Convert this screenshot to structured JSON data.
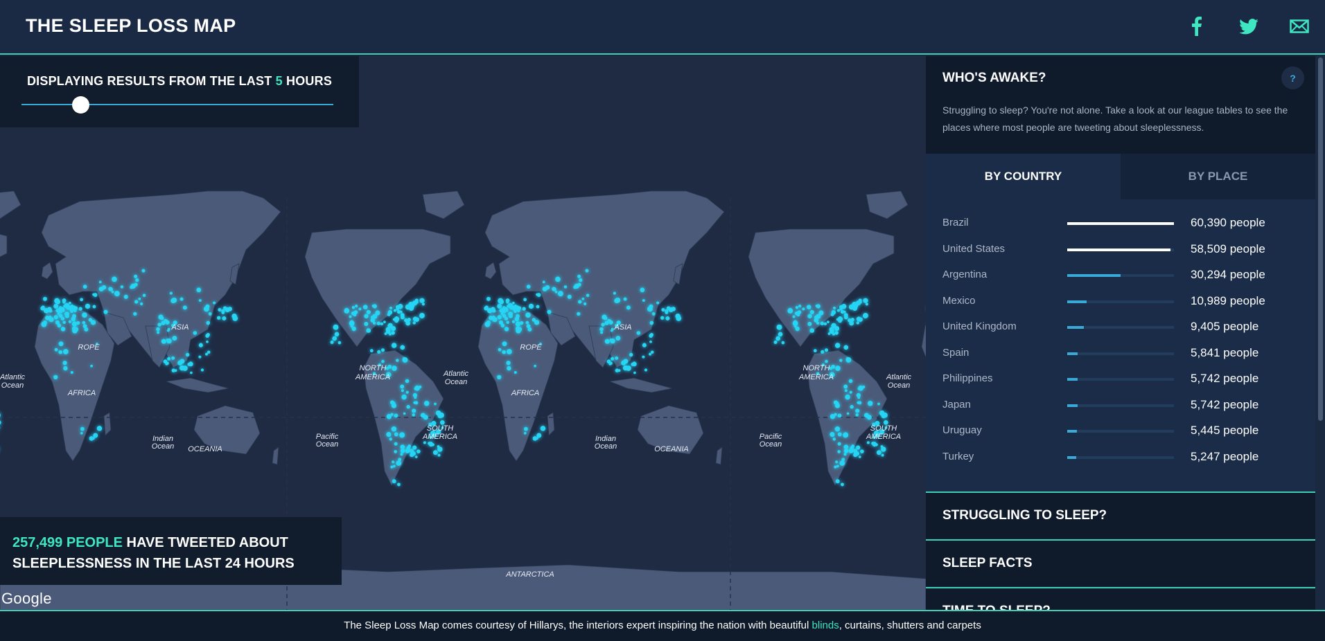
{
  "header": {
    "title": "THE SLEEP LOSS MAP",
    "social": [
      "facebook-icon",
      "twitter-icon",
      "mail-icon"
    ]
  },
  "slider": {
    "prefix": "DISPLAYING RESULTS FROM THE LAST",
    "value": "5",
    "suffix": "HOURS"
  },
  "map": {
    "labels": {
      "asia": "ASIA",
      "europe": "ROPE",
      "africa": "AFRICA",
      "oceania": "OCEANIA",
      "north_america_1": "NORTH",
      "north_america_2": "AMERICA",
      "south_america_1": "SOUTH",
      "south_america_2": "AMERICA",
      "atlantic_1": "Atlantic",
      "atlantic_2": "Ocean",
      "indian_1": "Indian",
      "indian_2": "Ocean",
      "pacific_1": "Pacific",
      "pacific_2": "Ocean",
      "antarctica": "ANTARCTICA"
    },
    "stats_count": "257,499 PEOPLE",
    "stats_text": "HAVE TWEETED ABOUT SLEEPLESSNESS IN THE LAST 24 HOURS",
    "google": "Google"
  },
  "sidebar": {
    "awake_title": "WHO'S AWAKE?",
    "help": "?",
    "awake_desc": "Struggling to sleep? You're not alone. Take a look at our league tables to see the places where most people are tweeting about sleeplessness.",
    "tabs": [
      {
        "label": "BY COUNTRY"
      },
      {
        "label": "BY PLACE"
      }
    ],
    "league": [
      {
        "name": "Brazil",
        "count": "60,390 people",
        "value": 60390
      },
      {
        "name": "United States",
        "count": "58,509 people",
        "value": 58509
      },
      {
        "name": "Argentina",
        "count": "30,294 people",
        "value": 30294
      },
      {
        "name": "Mexico",
        "count": "10,989 people",
        "value": 10989
      },
      {
        "name": "United Kingdom",
        "count": "9,405 people",
        "value": 9405
      },
      {
        "name": "Spain",
        "count": "5,841 people",
        "value": 5841
      },
      {
        "name": "Philippines",
        "count": "5,742 people",
        "value": 5742
      },
      {
        "name": "Japan",
        "count": "5,742 people",
        "value": 5742
      },
      {
        "name": "Uruguay",
        "count": "5,445 people",
        "value": 5445
      },
      {
        "name": "Turkey",
        "count": "5,247 people",
        "value": 5247
      }
    ],
    "accordions": [
      {
        "label": "STRUGGLING TO SLEEP?"
      },
      {
        "label": "SLEEP FACTS"
      },
      {
        "label": "TIME TO SLEEP?"
      }
    ]
  },
  "footer": {
    "text_before": "The Sleep Loss Map comes courtesy of Hillarys, the interiors expert inspiring the nation with beautiful ",
    "link": "blinds",
    "text_after": ", curtains, shutters and carpets"
  },
  "colors": {
    "accent": "#3ee6c1",
    "bar_top": "#ffffff",
    "bar": "#3ba9d8",
    "glow": "#25d4f4"
  }
}
